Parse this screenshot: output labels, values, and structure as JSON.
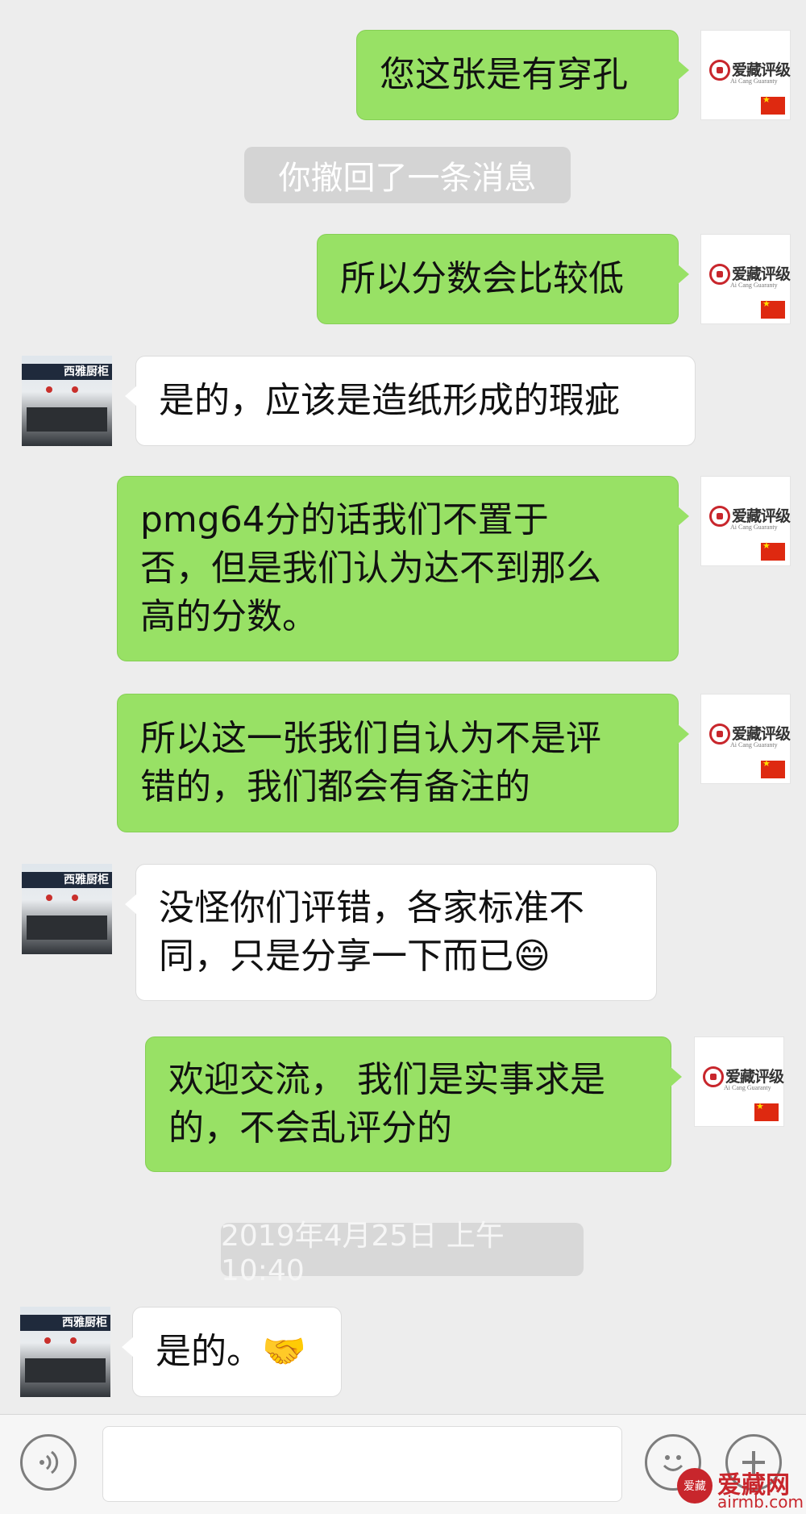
{
  "messages": [
    {
      "type": "me",
      "text": "您这张是有穿孔"
    },
    {
      "type": "system",
      "text": "你撤回了一条消息"
    },
    {
      "type": "me",
      "text": "所以分数会比较低"
    },
    {
      "type": "other",
      "text": "是的，应该是造纸形成的瑕疵"
    },
    {
      "type": "me",
      "text": "pmg64分的话我们不置于\n否，但是我们认为达不到那么\n高的分数。"
    },
    {
      "type": "me",
      "text": "所以这一张我们自认为不是评\n错的，我们都会有备注的"
    },
    {
      "type": "other",
      "text": "没怪你们评错，各家标准不\n同，只是分享一下而已😄"
    },
    {
      "type": "me",
      "text": "欢迎交流， 我们是实事求是\n的，不会乱评分的"
    },
    {
      "type": "time",
      "text": "2019年4月25日 上午10:40"
    },
    {
      "type": "other",
      "text": "是的。🤝"
    }
  ],
  "avatar_me": {
    "logo_text": "爱藏评级",
    "logo_sub": "Ai Cang Guaranty"
  },
  "avatar_other": {
    "sign_text": "西雅厨柜"
  },
  "input_bar": {
    "voice_icon": "voice-icon",
    "emoji_icon": "emoji-icon",
    "plus_icon": "plus-icon"
  },
  "watermark": {
    "seal": "爱藏",
    "text": "爱藏网",
    "url": "airmb.com"
  },
  "colors": {
    "background": "#ededed",
    "my_bubble": "#98e165",
    "other_bubble": "#ffffff",
    "system_pill": "#d4d4d4"
  }
}
